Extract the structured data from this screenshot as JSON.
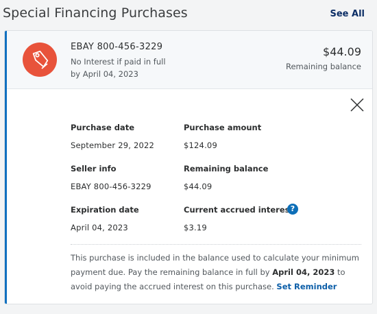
{
  "header": {
    "title": "Special Financing Purchases",
    "see_all": "See All"
  },
  "card": {
    "icon": "tag-icon",
    "accent_color": "#1070c0",
    "badge_color": "#e8533b",
    "merchant": "EBAY 800-456-3229",
    "promo_line1": "No Interest if paid in full",
    "promo_line2": "by April 04, 2023",
    "amount": "$44.09",
    "amount_label": "Remaining balance"
  },
  "details": {
    "purchase_date_label": "Purchase date",
    "purchase_date": "September 29, 2022",
    "purchase_amount_label": "Purchase amount",
    "purchase_amount": "$124.09",
    "seller_info_label": "Seller info",
    "seller_info": "EBAY 800-456-3229",
    "remaining_balance_label": "Remaining balance",
    "remaining_balance": "$44.09",
    "expiration_date_label": "Expiration date",
    "expiration_date": "April 04, 2023",
    "accrued_interest_label": "Current accrued interest",
    "accrued_interest": "$3.19",
    "help_icon": "?"
  },
  "note": {
    "text1": "This purchase is included in the balance used to calculate your minimum payment due. Pay the remaining balance in full by ",
    "date": "April 04, 2023",
    "text2": " to avoid paying the accrued interest on this purchase. ",
    "reminder": "Set Reminder"
  }
}
